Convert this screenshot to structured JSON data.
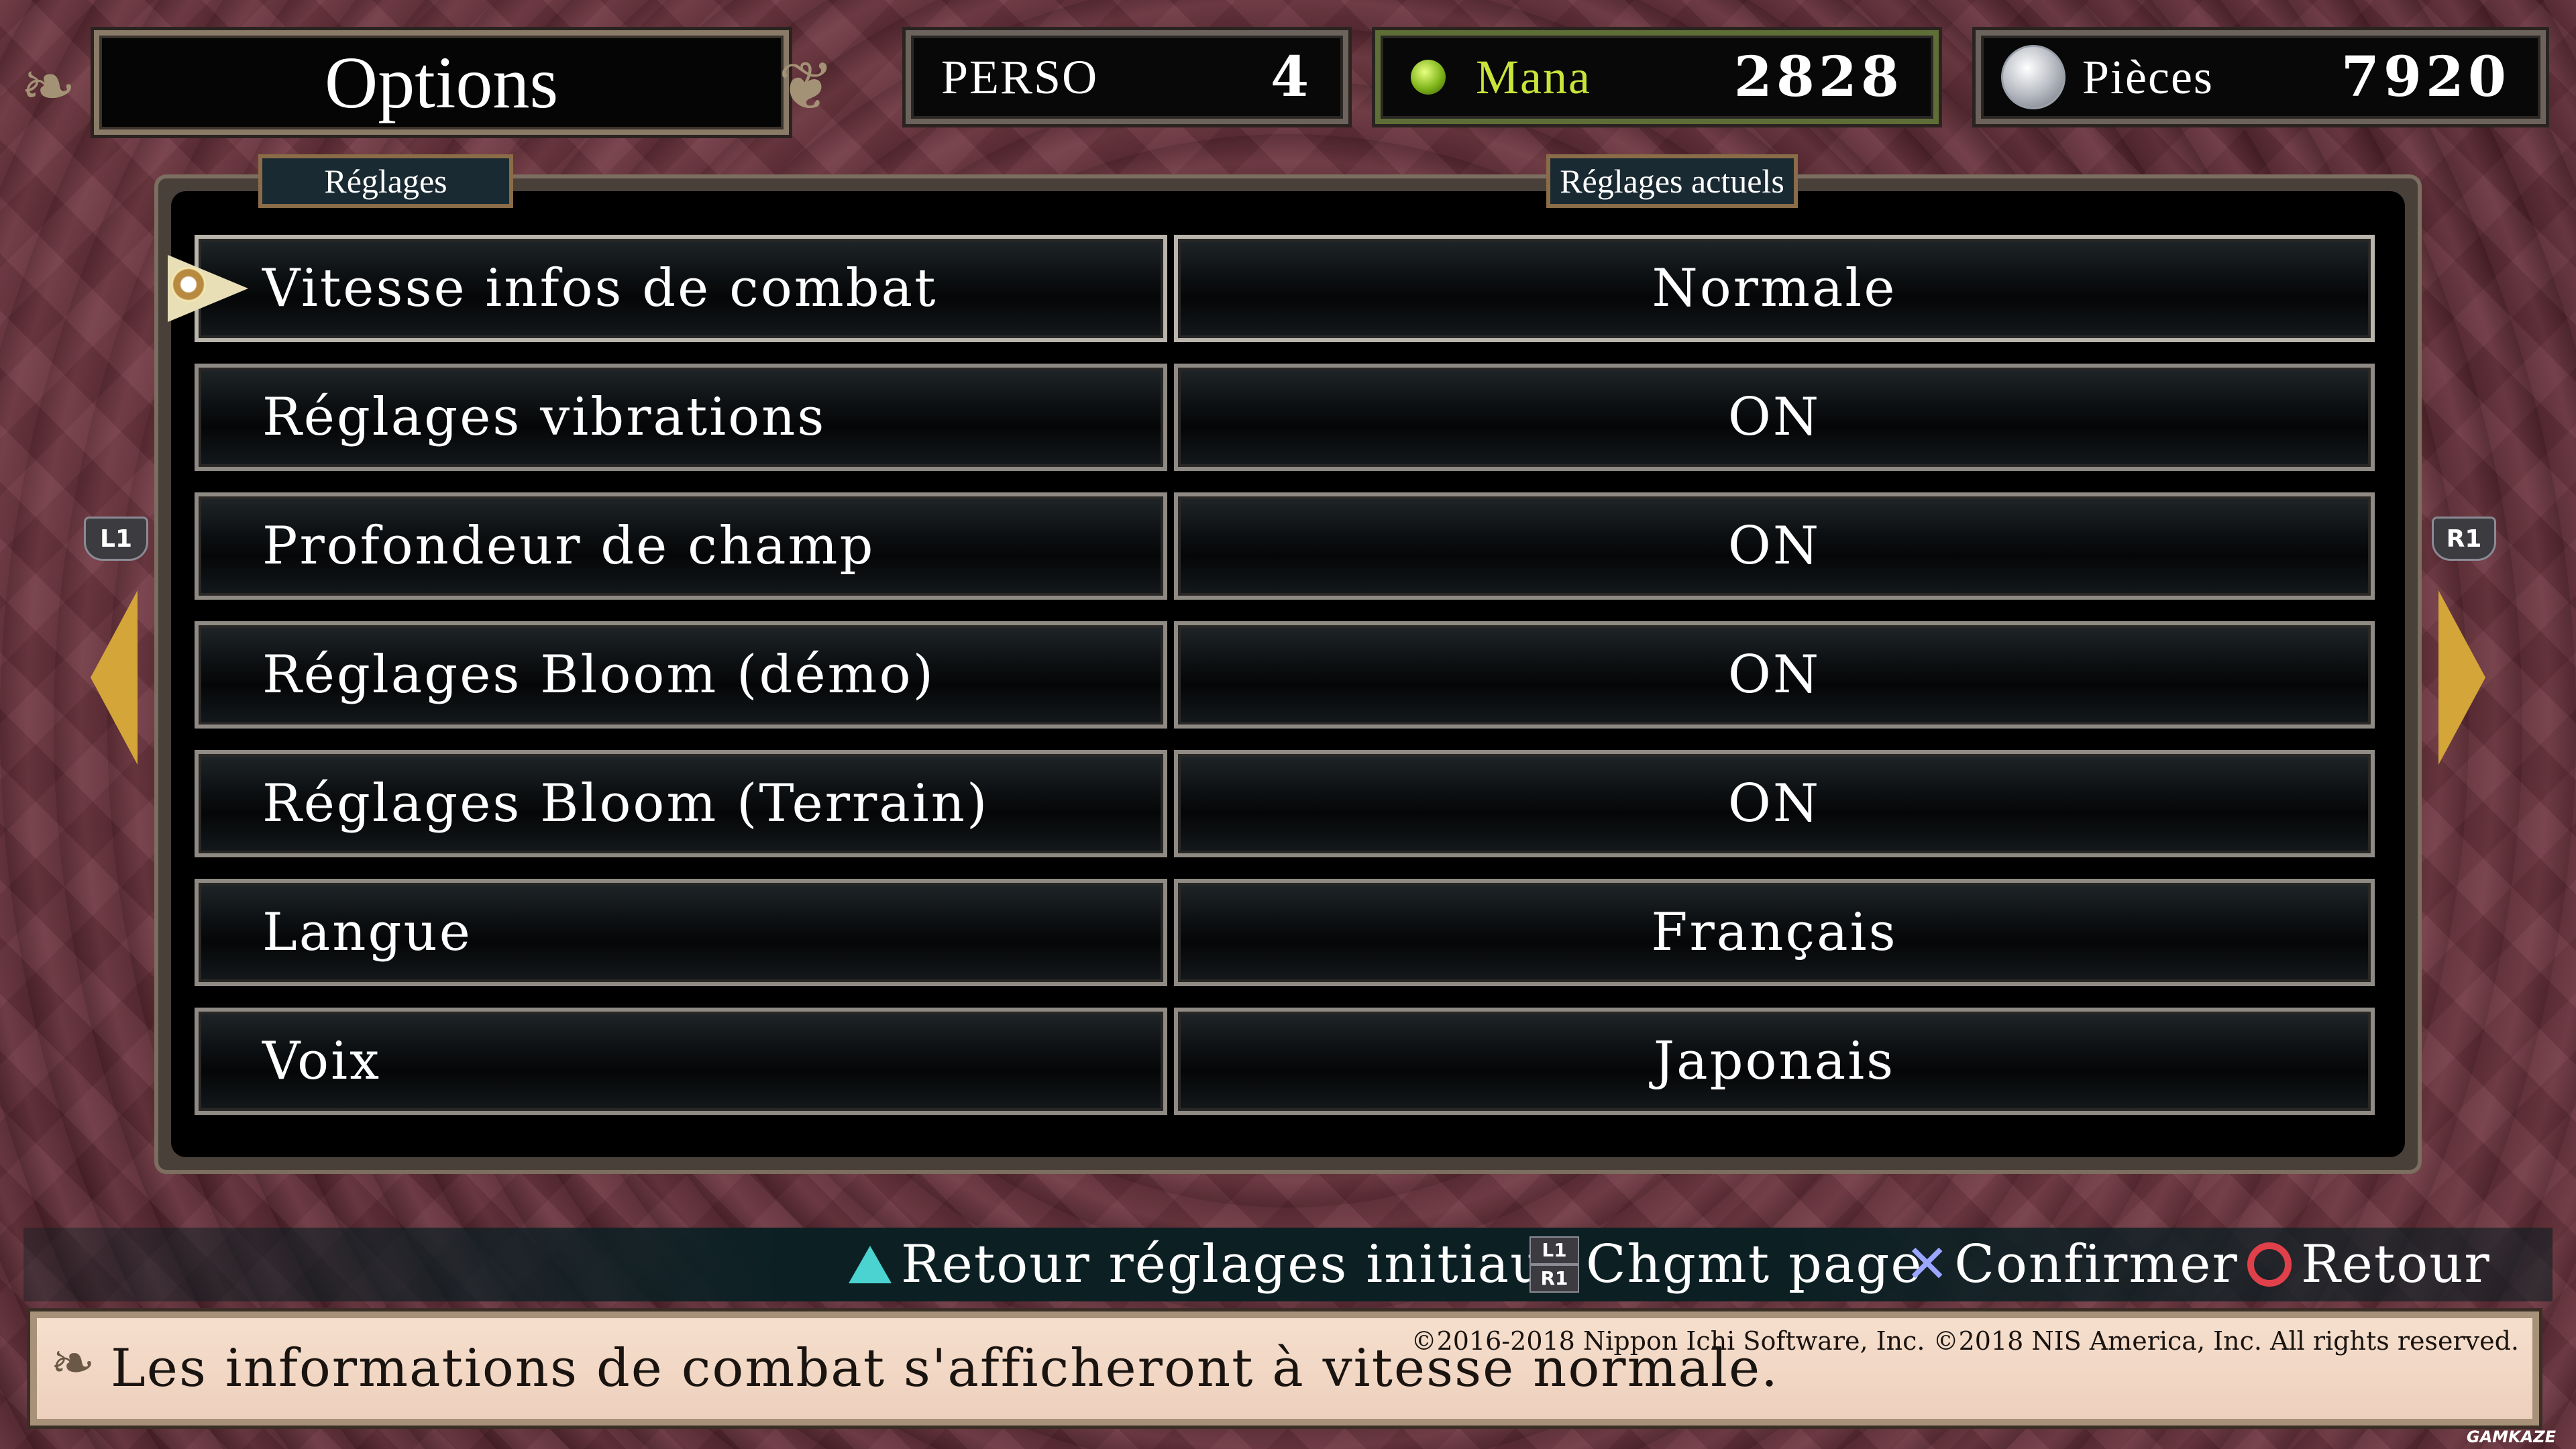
{
  "header": {
    "title": "Options",
    "stats": [
      {
        "label": "PERSO",
        "value": "4"
      },
      {
        "label": "Mana",
        "value": "2828"
      },
      {
        "label": "Pièces",
        "value": "7920"
      }
    ]
  },
  "columns": {
    "left": "Réglages",
    "right": "Réglages actuels"
  },
  "nav": {
    "prev_shoulder": "L1",
    "next_shoulder": "R1"
  },
  "settings": [
    {
      "name": "Vitesse infos de combat",
      "value": "Normale",
      "selected": true
    },
    {
      "name": "Réglages vibrations",
      "value": "ON"
    },
    {
      "name": "Profondeur de champ",
      "value": "ON"
    },
    {
      "name": "Réglages Bloom (démo)",
      "value": "ON"
    },
    {
      "name": "Réglages Bloom (Terrain)",
      "value": "ON"
    },
    {
      "name": "Langue",
      "value": "Français"
    },
    {
      "name": "Voix",
      "value": "Japonais"
    }
  ],
  "controls": {
    "reset": "Retour réglages initiaux",
    "page_l1": "L1",
    "page_r1": "R1",
    "page": "Chgmt page",
    "confirm": "Confirmer",
    "back": "Retour"
  },
  "info": {
    "description": "Les informations de combat s'afficheront à vitesse normale.",
    "copyright": "©2016-2018 Nippon Ichi Software, Inc. ©2018 NIS America, Inc. All rights reserved."
  },
  "watermark": "GAMKAZE",
  "colors": {
    "mana_label": "#c9e53a",
    "arrow": "#d4a63a",
    "triangle": "#4ad3d0",
    "circle": "#e0404a",
    "cross": "#9aa6ff"
  }
}
